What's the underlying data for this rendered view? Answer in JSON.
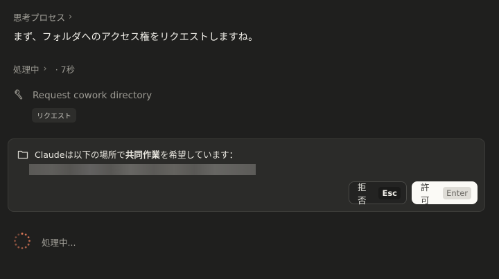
{
  "thinking": {
    "label": "思考プロセス",
    "chevron": "›"
  },
  "message": "まず、フォルダへのアクセス権をリクエストしますね。",
  "processing": {
    "label": "処理中",
    "chevron": "›",
    "duration": "· 7秒"
  },
  "tool": {
    "icon": "wrench-icon",
    "name": "Request cowork directory",
    "badge": "リクエスト"
  },
  "permission": {
    "icon": "folder-icon",
    "text_prefix": "Claudeは以下の場所で",
    "text_bold": "共同作業",
    "text_suffix": "を希望しています：",
    "path_redacted": true,
    "deny_label": "拒否",
    "deny_key": "Esc",
    "allow_label": "許可",
    "allow_key": "Enter"
  },
  "status": {
    "icon": "spinner-icon",
    "text": "処理中..."
  },
  "colors": {
    "background": "#1f1f1e",
    "card": "#2b2b29",
    "accent": "#d97757",
    "allow_button": "#fbfaf6"
  }
}
